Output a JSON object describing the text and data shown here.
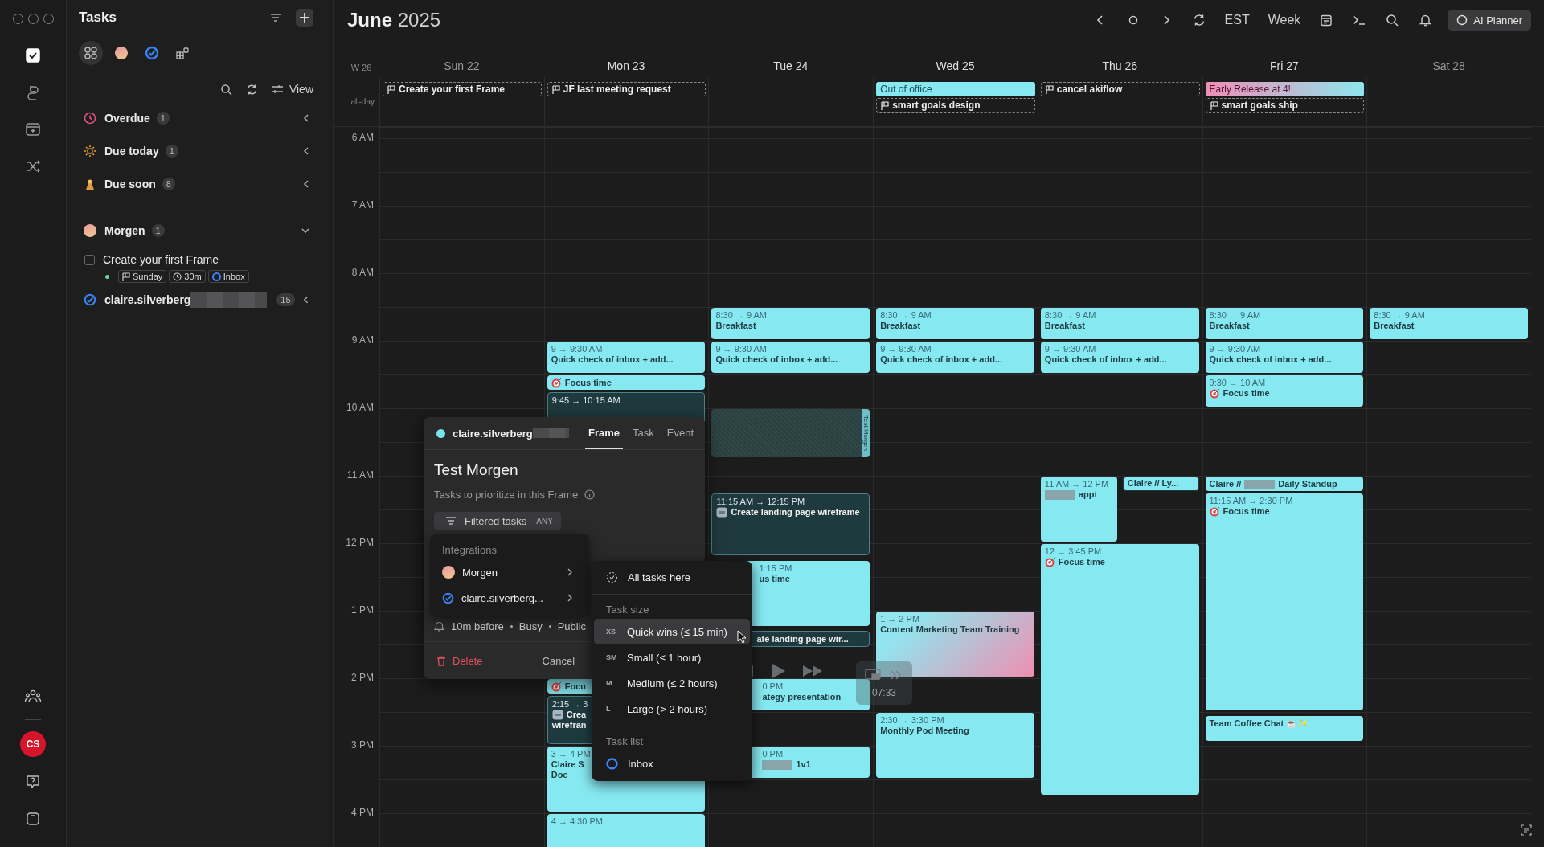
{
  "rail": {
    "items": [
      {
        "kind": "tasks",
        "selected": true
      },
      {
        "kind": "loop",
        "selected": false
      },
      {
        "kind": "inbox",
        "selected": false
      },
      {
        "kind": "shuffle",
        "selected": false
      }
    ],
    "bottom": [
      {
        "kind": "people"
      },
      {
        "kind": "avatar",
        "initials": "CS"
      },
      {
        "kind": "help"
      },
      {
        "kind": "window"
      }
    ]
  },
  "sidebar": {
    "title": "Tasks",
    "sources": [
      {
        "kind": "all",
        "selected": true
      },
      {
        "kind": "morgen",
        "selected": false
      },
      {
        "kind": "account",
        "selected": false
      },
      {
        "kind": "integrations",
        "selected": false
      }
    ],
    "view_label": "View",
    "smart_lists": [
      {
        "kind": "overdue",
        "label": "Overdue",
        "count": "1"
      },
      {
        "kind": "today",
        "label": "Due today",
        "count": "1"
      },
      {
        "kind": "soon",
        "label": "Due soon",
        "count": "8"
      }
    ],
    "groups": [
      {
        "kind": "morgen",
        "label": "Morgen",
        "count": "1",
        "expanded": true,
        "redacted": false,
        "tasks": [
          {
            "title": "Create your first Frame",
            "checked": false,
            "chips": [
              {
                "kind": "date",
                "label": "Sunday"
              },
              {
                "kind": "duration",
                "label": "30m"
              },
              {
                "kind": "list",
                "label": "Inbox"
              }
            ]
          }
        ]
      },
      {
        "kind": "account",
        "label": "claire.silverberg",
        "count": "15",
        "expanded": false,
        "redacted": true
      }
    ]
  },
  "calendar": {
    "month": "June",
    "year": "2025",
    "timezone": "EST",
    "view": "Week",
    "ai_button": "AI Planner",
    "week_label": "W 26",
    "allday_label": "all-day",
    "hours": [
      "6 AM",
      "7 AM",
      "8 AM",
      "9 AM",
      "10 AM",
      "11 AM",
      "12 PM",
      "1 PM",
      "2 PM",
      "3 PM",
      "4 PM"
    ],
    "days": [
      {
        "label": "Sun 22",
        "weekend": true,
        "allday": [
          {
            "kind": "frame",
            "title": "Create your first Frame"
          }
        ]
      },
      {
        "label": "Mon 23",
        "weekend": false,
        "allday": [
          {
            "kind": "frame",
            "title": "JF last meeting request"
          }
        ],
        "events": [
          {
            "kind": "light",
            "time": "9 → 9:30 AM",
            "title": "Quick check of inbox + add..."
          },
          {
            "kind": "light",
            "title": "Focus time",
            "focus": true
          },
          {
            "kind": "dark",
            "time": "9:45 → 10:15 AM"
          },
          {
            "kind": "light",
            "title": "Focu",
            "focus": true
          },
          {
            "kind": "dark",
            "time": "2:15 → 3",
            "title": "Crea",
            "title_2": "wirefran",
            "tag": true
          },
          {
            "kind": "light",
            "time": "3 → 4 PM",
            "title": "Claire S",
            "title_2": "Doe"
          },
          {
            "kind": "light",
            "time": "4 → 4:30 PM"
          }
        ]
      },
      {
        "label": "Tue 24",
        "weekend": false,
        "events": [
          {
            "kind": "light",
            "time": "8:30 → 9 AM",
            "title": "Breakfast"
          },
          {
            "kind": "light",
            "time": "9 → 9:30 AM",
            "title": "Quick check of inbox + add..."
          },
          {
            "kind": "frame",
            "title": "Test Morgen"
          },
          {
            "kind": "dark",
            "time": "11:15 AM → 12:15 PM",
            "title": "Create landing page wireframe",
            "tag": true
          },
          {
            "kind": "light",
            "time": "1:15 PM",
            "title": "us time"
          },
          {
            "kind": "dark",
            "title": "ate landing page wir..."
          },
          {
            "kind": "light",
            "time": "0 PM",
            "title": "ategy presentation"
          },
          {
            "kind": "light",
            "time": "0 PM",
            "title": "1v1",
            "redacted": true
          }
        ]
      },
      {
        "label": "Wed 25",
        "weekend": false,
        "allday": [
          {
            "kind": "event",
            "title": "Out of office"
          },
          {
            "kind": "frame",
            "title": "smart goals design"
          }
        ],
        "events": [
          {
            "kind": "light",
            "time": "8:30 → 9 AM",
            "title": "Breakfast"
          },
          {
            "kind": "light",
            "time": "9 → 9:30 AM",
            "title": "Quick check of inbox + add..."
          },
          {
            "kind": "gradient",
            "time": "1 → 2 PM",
            "title": "Content Marketing Team Training"
          },
          {
            "kind": "light",
            "time": "2:30 → 3:30 PM",
            "title": "Monthly Pod Meeting"
          }
        ]
      },
      {
        "label": "Thu 26",
        "weekend": false,
        "allday": [
          {
            "kind": "frame",
            "title": "cancel akiflow"
          }
        ],
        "events": [
          {
            "kind": "light",
            "time": "8:30 → 9 AM",
            "title": "Breakfast"
          },
          {
            "kind": "light",
            "time": "9 → 9:30 AM",
            "title": "Quick check of inbox + add..."
          },
          {
            "kind": "light",
            "time": "11 AM → 12 PM",
            "title": "appt",
            "redacted": true
          },
          {
            "kind": "outline",
            "title": "Claire // Ly..."
          },
          {
            "kind": "light",
            "time": "12 → 3:45 PM",
            "title": "Focus time",
            "focus": true
          }
        ]
      },
      {
        "label": "Fri 27",
        "weekend": false,
        "allday": [
          {
            "kind": "gradient",
            "title": "Early Release at 4!"
          },
          {
            "kind": "frame",
            "title": "smart goals ship"
          }
        ],
        "events": [
          {
            "kind": "light",
            "time": "8:30 → 9 AM",
            "title": "Breakfast"
          },
          {
            "kind": "light",
            "time": "9 → 9:30 AM",
            "title": "Quick check of inbox + add..."
          },
          {
            "kind": "light",
            "time": "9:30 → 10 AM",
            "title": "Focus time",
            "focus": true
          },
          {
            "kind": "light",
            "prefix": "Claire //",
            "title": "Daily Standup",
            "redacted": true
          },
          {
            "kind": "light",
            "time": "11:15 AM → 2:30 PM",
            "title": "Focus time",
            "focus": true
          },
          {
            "kind": "light",
            "title": "Team Coffee Chat ☕✨"
          }
        ]
      },
      {
        "label": "Sat 28",
        "weekend": true,
        "events": [
          {
            "kind": "light",
            "time": "8:30 → 9 AM",
            "title": "Breakfast"
          }
        ]
      }
    ]
  },
  "frame_popup": {
    "account": "claire.silverberg",
    "tabs": [
      {
        "label": "Frame",
        "selected": true
      },
      {
        "label": "Task",
        "selected": false
      },
      {
        "label": "Event",
        "selected": false
      }
    ],
    "title": "Test Morgen",
    "subtitle": "Tasks to prioritize in this Frame",
    "filter_label": "Filtered tasks",
    "filter_badge": "ANY",
    "details": [
      "10m before",
      "Busy",
      "Public"
    ],
    "delete_label": "Delete",
    "cancel_label": "Cancel"
  },
  "integrations_menu": {
    "heading": "Integrations",
    "items": [
      {
        "kind": "morgen",
        "label": "Morgen"
      },
      {
        "kind": "account",
        "label": "claire.silverberg..."
      }
    ]
  },
  "filter_menu": {
    "all_label": "All tasks here",
    "size_heading": "Task size",
    "sizes": [
      {
        "code": "XS",
        "label": "Quick wins (≤ 15 min)",
        "selected": true
      },
      {
        "code": "SM",
        "label": "Small (≤ 1 hour)",
        "selected": false
      },
      {
        "code": "M",
        "label": "Medium (≤ 2 hours)",
        "selected": false
      },
      {
        "code": "L",
        "label": "Large (> 2 hours)",
        "selected": false
      }
    ],
    "list_heading": "Task list",
    "lists": [
      {
        "label": "Inbox"
      }
    ]
  },
  "media_overlay": {
    "time": "07:33"
  }
}
